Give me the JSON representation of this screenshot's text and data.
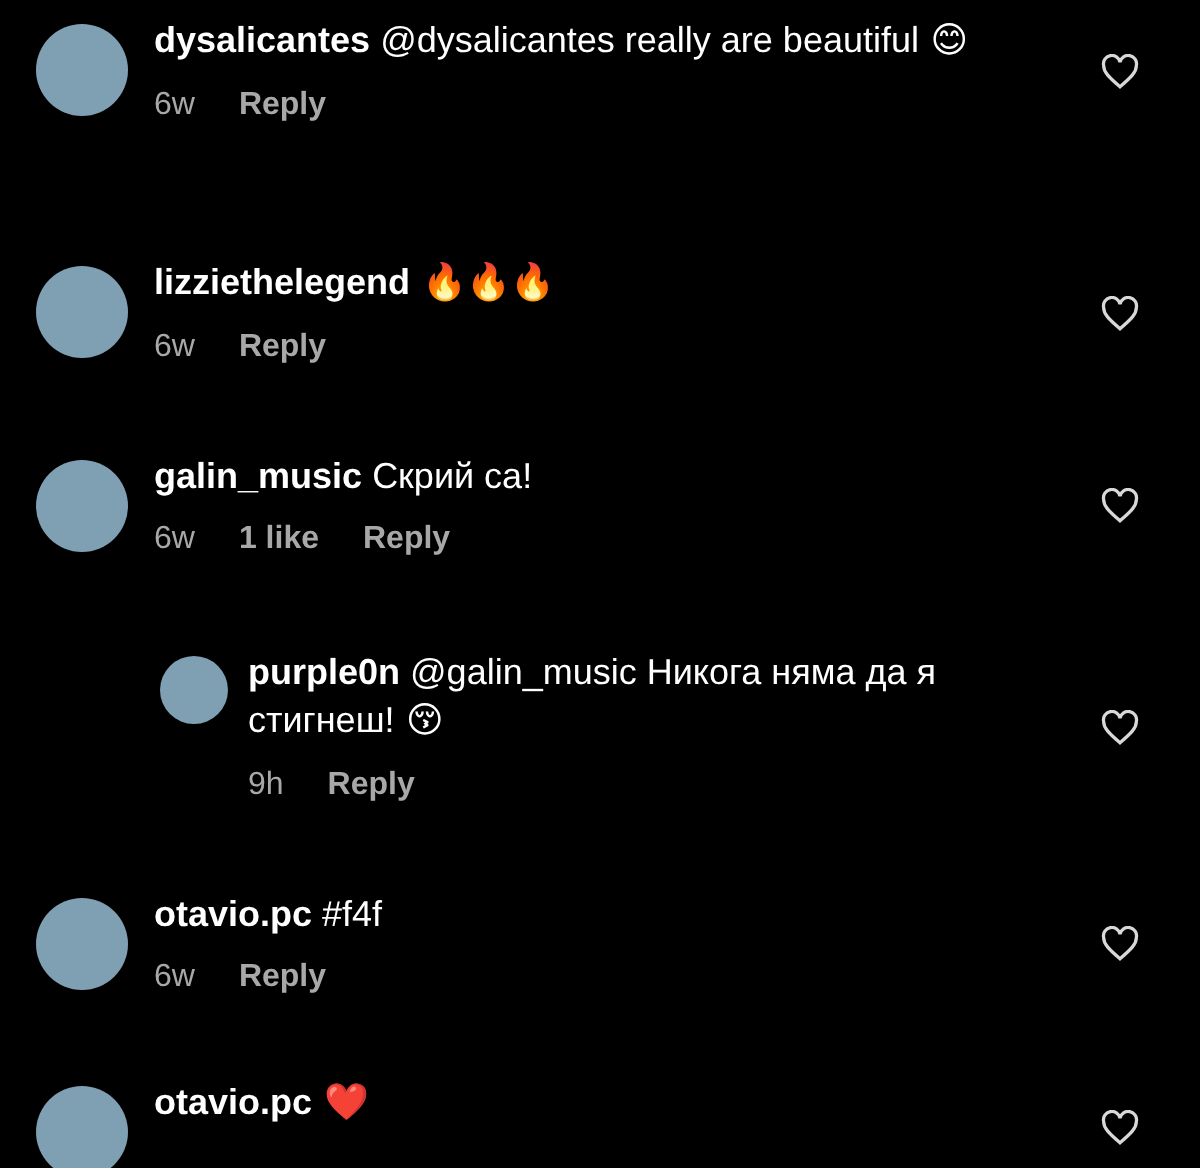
{
  "comments": [
    {
      "username": "dysalicantes",
      "text": "@dysalicantes really are beautiful",
      "emoji": "😊",
      "time": "6w",
      "reply": "Reply",
      "reply_level": false
    },
    {
      "username": "lizziethelegend",
      "emoji": "🔥🔥🔥",
      "time": "6w",
      "reply": "Reply",
      "reply_level": false
    },
    {
      "username": "galin_music",
      "text": "Скрий са!",
      "time": "6w",
      "likes": "1 like",
      "reply": "Reply",
      "reply_level": false
    },
    {
      "username": "purple0n",
      "text": "@galin_music Никога няма да я стигнеш!",
      "emoji": "😚",
      "time": "9h",
      "reply": "Reply",
      "reply_level": true
    },
    {
      "username": "otavio.pc",
      "text": "#f4f",
      "time": "6w",
      "reply": "Reply",
      "reply_level": false
    },
    {
      "username": "otavio.pc",
      "emoji": "❤️",
      "reply_level": false
    }
  ]
}
